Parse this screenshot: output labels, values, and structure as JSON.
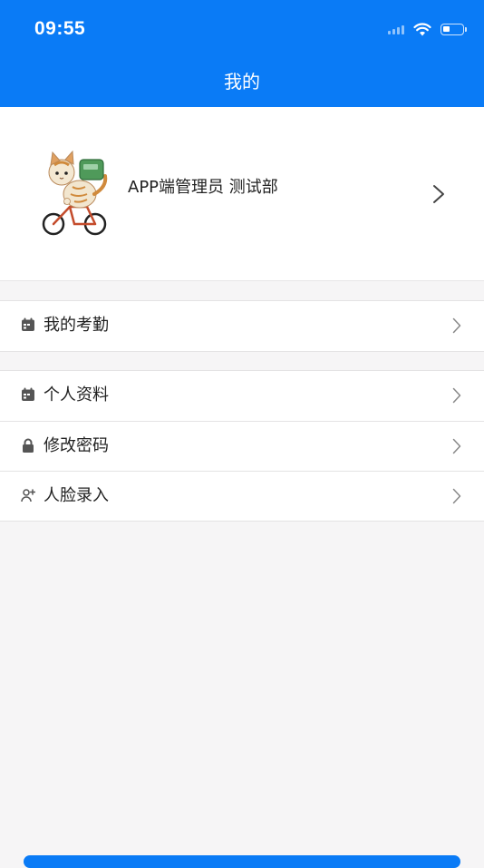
{
  "status_bar": {
    "time": "09:55",
    "battery_level": 0.35
  },
  "header": {
    "title": "我的",
    "background_color": "#0a7bf6"
  },
  "profile": {
    "name": "APP端管理员 测试部",
    "avatar_icon": "cat-on-bicycle-avatar",
    "chevron_icon": "chevron-right-icon"
  },
  "menu": {
    "attendance": {
      "label": "我的考勤",
      "icon": "calendar-icon"
    },
    "personal_info": {
      "label": "个人资料",
      "icon": "calendar-icon"
    },
    "change_password": {
      "label": "修改密码",
      "icon": "lock-icon"
    },
    "face_enroll": {
      "label": "人脸录入",
      "icon": "add-user-icon"
    }
  },
  "colors": {
    "accent": "#0a7bf6",
    "page_background": "#f6f5f6",
    "divider": "#e4e3e4"
  }
}
